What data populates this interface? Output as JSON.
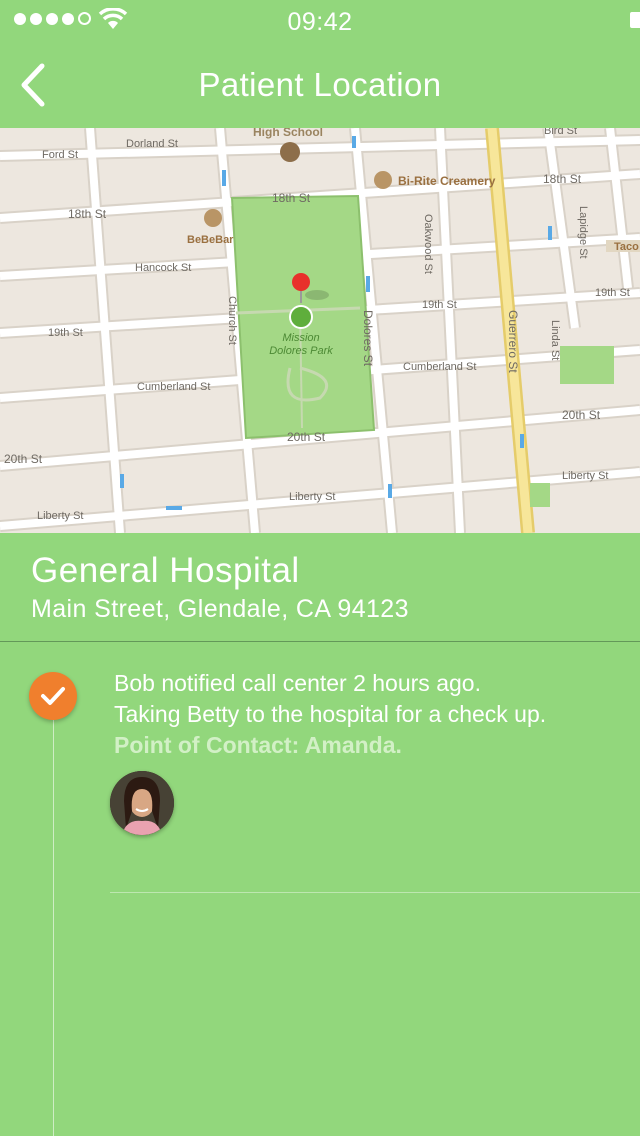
{
  "status_bar": {
    "time": "09:42",
    "signal_bars_filled": 4,
    "signal_bars_total": 5
  },
  "nav": {
    "title": "Patient Location",
    "back_icon": "chevron-left-icon"
  },
  "map": {
    "streets": [
      "Dorland St",
      "Ford St",
      "18th St",
      "Hancock St",
      "19th St",
      "Cumberland St",
      "20th St",
      "Liberty St",
      "Church St",
      "Dolores St",
      "Oakwood St",
      "Guerrero St",
      "Lapidge St",
      "Linda St",
      "Bird St"
    ],
    "pois": [
      "High School",
      "Bi-Rite Creamery",
      "BeBeBar",
      "Mission Dolores Park",
      "Taco"
    ],
    "pin_icon": "map-pin-icon",
    "park_name": [
      "Mission",
      "Dolores Park"
    ]
  },
  "location": {
    "name": "General Hospital",
    "address": "Main Street, Glendale, CA 94123"
  },
  "timeline": {
    "status_icon": "checkmark-icon",
    "status_color": "#f07f2d",
    "line1": "Bob notified call center 2 hours ago.",
    "line2": "Taking Betty to the hospital for a check up.",
    "contact": "Point of Contact: Amanda."
  },
  "colors": {
    "background": "#92d77c",
    "map_background": "#ede7df",
    "park_green": "#a4d886"
  }
}
